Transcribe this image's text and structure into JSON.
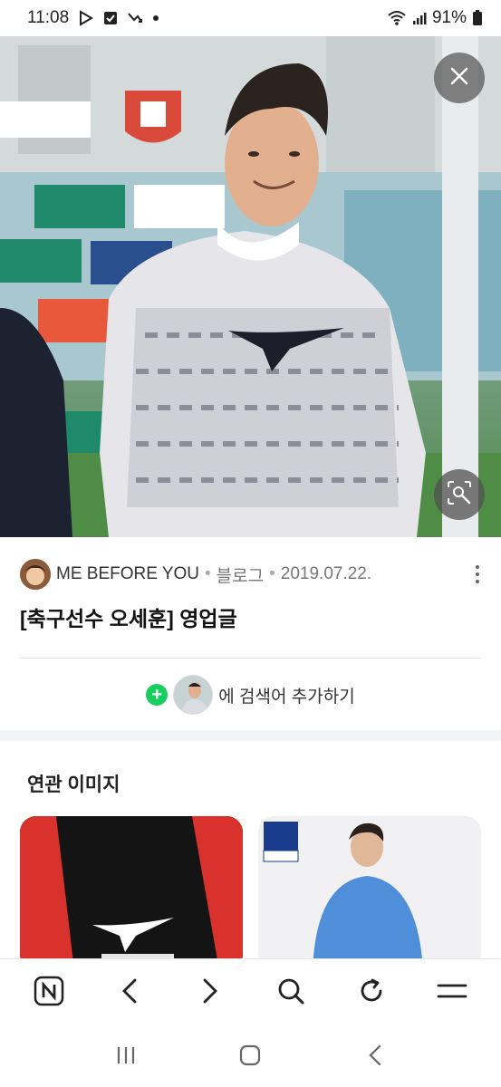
{
  "status_bar": {
    "time": "11:08",
    "battery": "91%",
    "icons": [
      "play-store-icon",
      "checkbox-icon",
      "missed-call-icon",
      "notification-dot-icon",
      "wifi-icon",
      "signal-icon",
      "battery-icon"
    ]
  },
  "hero": {
    "close_icon": "close-icon",
    "lens_icon": "lens-search-icon"
  },
  "source": {
    "name": "ME BEFORE YOU",
    "type": "블로그",
    "separator": "•",
    "date": "2019.07.22."
  },
  "post_title": "[축구선수 오세훈] 영업글",
  "add_search": {
    "plus": "+",
    "label": "에 검색어 추가하기"
  },
  "related": {
    "title": "연관 이미지"
  },
  "bottom_nav": {
    "items": [
      "naver-home-icon",
      "back-icon",
      "forward-icon",
      "search-icon",
      "refresh-icon",
      "menu-icon"
    ]
  },
  "system_nav": {
    "items": [
      "recent-apps-icon",
      "home-icon",
      "back-icon"
    ]
  },
  "colors": {
    "accent_green": "#19ce60",
    "text_dark": "#111111",
    "text_muted": "#777777"
  }
}
